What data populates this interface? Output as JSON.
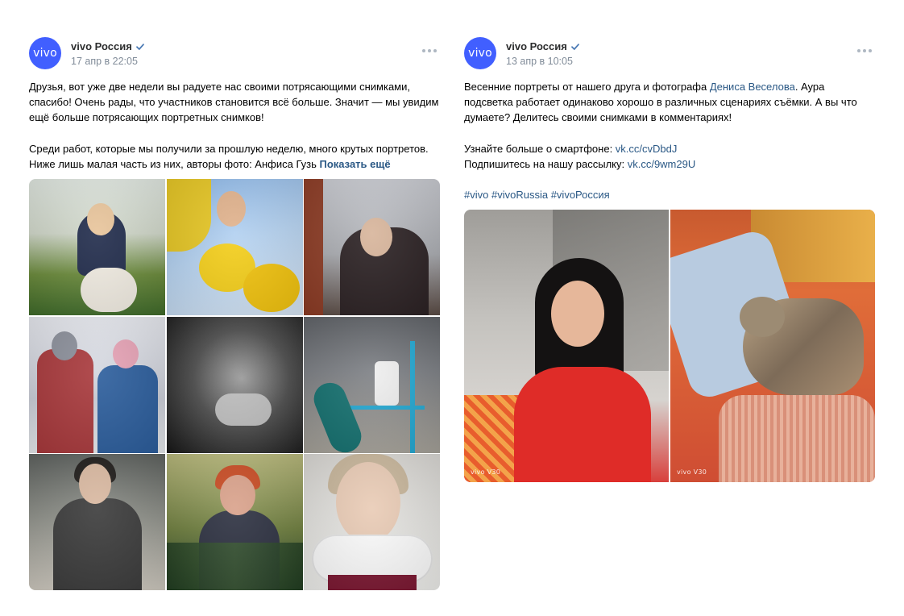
{
  "posts": [
    {
      "author": "vivo Россия",
      "avatar_text": "vivo",
      "date": "17 апр в 22:05",
      "text": {
        "p1": "Друзья, вот уже две недели вы радуете нас своими потрясающими снимками, спасибо! Очень рады, что участников становится всё больше. Значит — мы увидим ещё больше потрясающих портретных снимков!",
        "p2": "Среди работ, которые мы получили за прошлую неделю, много крутых портретов. Ниже лишь малая часть из них, авторы фото: Анфиса Гузь",
        "show_more": "Показать ещё"
      },
      "photo_count": 9
    },
    {
      "author": "vivo Россия",
      "avatar_text": "vivo",
      "date": "13 апр в 10:05",
      "text": {
        "p1_before": "Весенние портреты от нашего друга и фотографа ",
        "p1_link": "Дениса Веселова",
        "p1_after": ". Аура подсветка работает одинаково хорошо в различных сценариях съёмки. А вы что думаете? Делитесь своими снимками в комментариях!",
        "line1_label": "Узнайте больше о смартфоне: ",
        "line1_link": "vk.cc/cvDbdJ",
        "line2_label": "Подпишитесь на нашу рассылку: ",
        "line2_link": "vk.cc/9wm29U",
        "hashtags": [
          "#vivo",
          "#vivoRussia",
          "#vivoРоссия"
        ]
      },
      "photo_watermarks": [
        "vivo V30",
        "vivo V30"
      ]
    }
  ],
  "colors": {
    "avatar_bg": "#415fff",
    "link": "#2a5885",
    "meta": "#818c99"
  }
}
